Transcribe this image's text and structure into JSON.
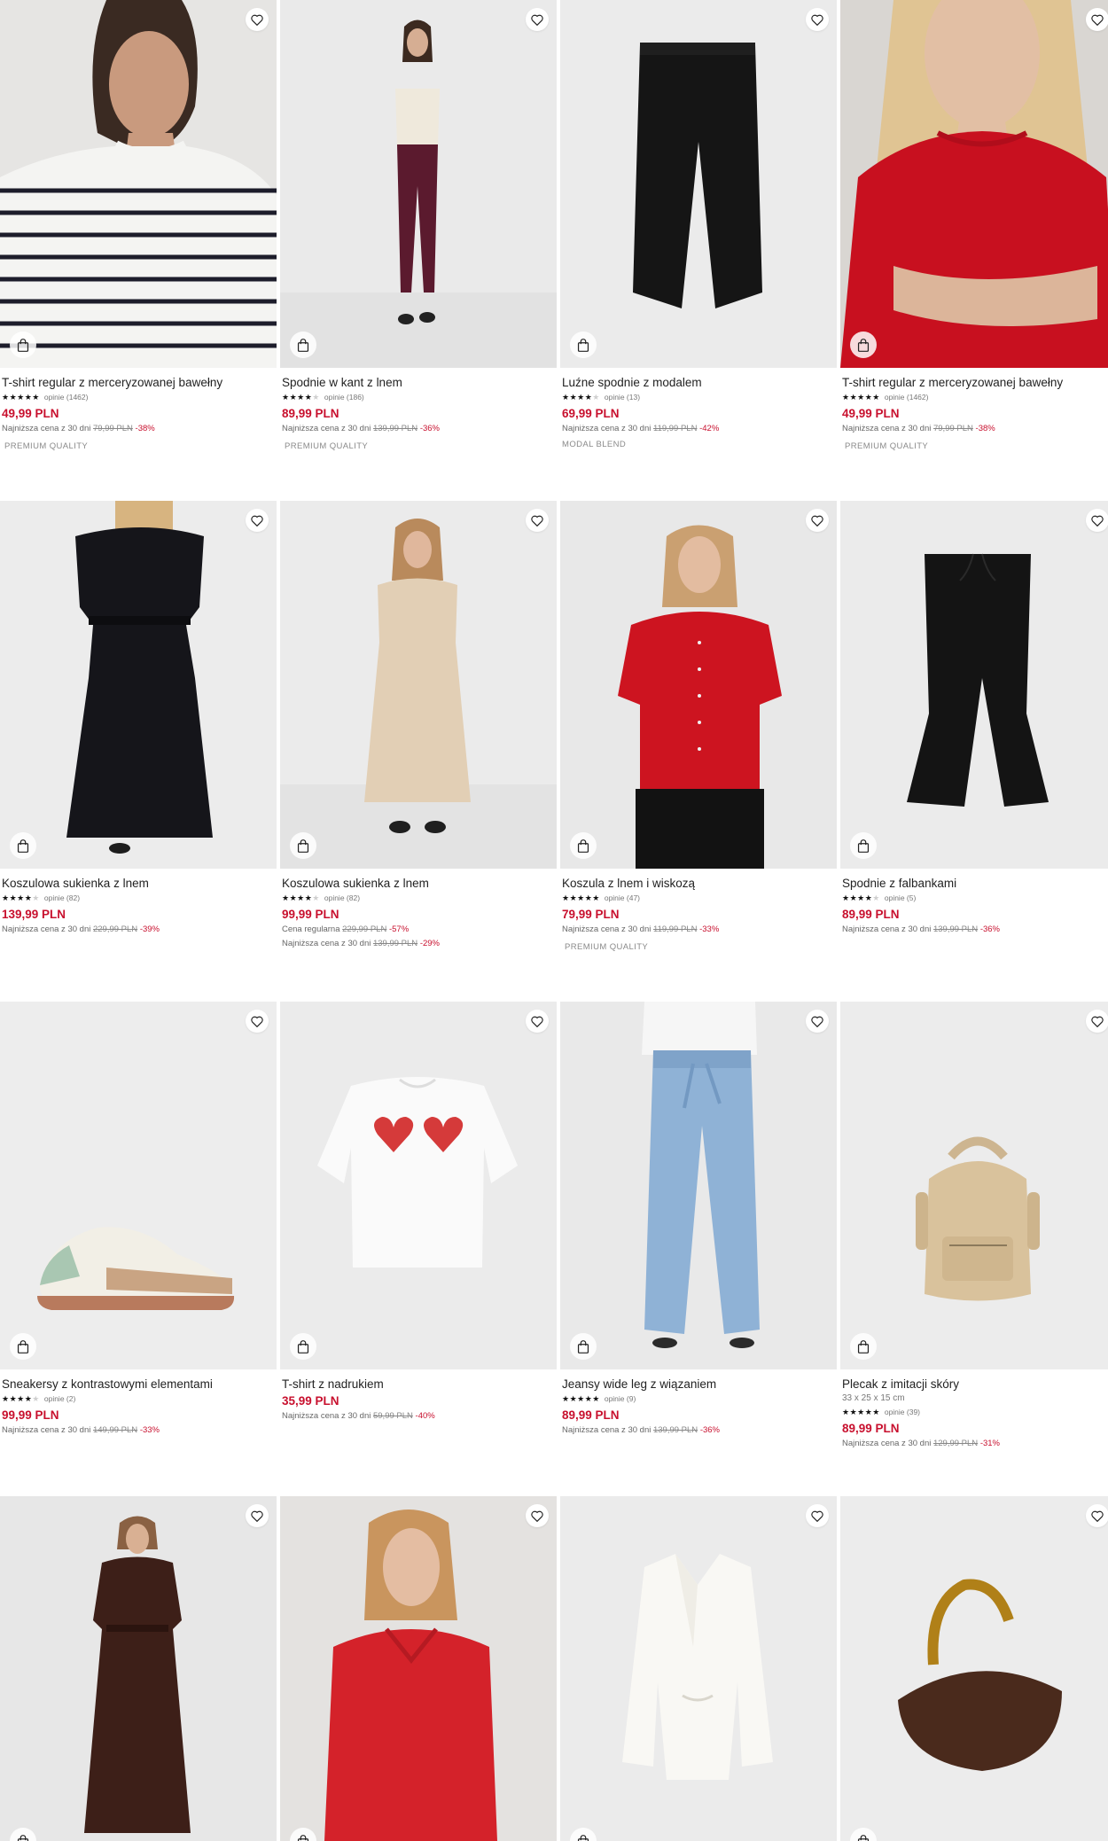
{
  "colors": {
    "accent": "#c8102e",
    "text": "#222222",
    "muted": "#777777",
    "star": "#111111"
  },
  "products": [
    {
      "name": "T-shirt regular z merceryzowanej bawełny",
      "rating": 5,
      "reviews": "opinie (1462)",
      "price": "49,99 PLN",
      "note_label": "Najniższa cena z 30 dni",
      "old_price": "79,99 PLN",
      "discount": "-38%",
      "tag": "PREMIUM QUALITY",
      "image": "striped-tshirt"
    },
    {
      "name": "Spodnie w kant z lnem",
      "rating": 4.5,
      "reviews": "opinie (186)",
      "price": "89,99 PLN",
      "note_label": "Najniższa cena z 30 dni",
      "old_price": "139,99 PLN",
      "discount": "-36%",
      "tag": "PREMIUM QUALITY",
      "image": "burgundy-trousers"
    },
    {
      "name": "Luźne spodnie z modalem",
      "rating": 4.5,
      "reviews": "opinie (13)",
      "price": "69,99 PLN",
      "note_label": "Najniższa cena z 30 dni",
      "old_price": "119,99 PLN",
      "discount": "-42%",
      "tag": "MODAL BLEND",
      "image": "black-wide-pants"
    },
    {
      "name": "T-shirt regular z merceryzowanej bawełny",
      "rating": 5,
      "reviews": "opinie (1462)",
      "price": "49,99 PLN",
      "note_label": "Najniższa cena z 30 dni",
      "old_price": "79,99 PLN",
      "discount": "-38%",
      "tag": "PREMIUM QUALITY",
      "image": "red-tshirt"
    },
    {
      "name": "Koszulowa sukienka z lnem",
      "rating": 4.5,
      "reviews": "opinie (82)",
      "price": "139,99 PLN",
      "note_label": "Najniższa cena z 30 dni",
      "old_price": "229,99 PLN",
      "discount": "-39%",
      "image": "black-shirt-dress"
    },
    {
      "name": "Koszulowa sukienka z lnem",
      "rating": 4.5,
      "reviews": "opinie (82)",
      "price": "99,99 PLN",
      "regular_label": "Cena regularna",
      "regular_old": "229,99 PLN",
      "regular_discount": "-57%",
      "note_label": "Najniższa cena z 30 dni",
      "old_price": "139,99 PLN",
      "discount": "-29%",
      "image": "beige-shirt-dress"
    },
    {
      "name": "Koszula z lnem i wiskozą",
      "rating": 5,
      "reviews": "opinie (47)",
      "price": "79,99 PLN",
      "note_label": "Najniższa cena z 30 dni",
      "old_price": "119,99 PLN",
      "discount": "-33%",
      "tag": "PREMIUM QUALITY",
      "image": "red-shirt"
    },
    {
      "name": "Spodnie z falbankami",
      "rating": 4.5,
      "reviews": "opinie (5)",
      "price": "89,99 PLN",
      "note_label": "Najniższa cena z 30 dni",
      "old_price": "139,99 PLN",
      "discount": "-36%",
      "image": "black-knit-pants"
    },
    {
      "name": "Sneakersy z kontrastowymi elementami",
      "rating": 4,
      "reviews": "opinie (2)",
      "price": "99,99 PLN",
      "note_label": "Najniższa cena z 30 dni",
      "old_price": "149,99 PLN",
      "discount": "-33%",
      "image": "sneaker"
    },
    {
      "name": "T-shirt z nadrukiem",
      "price": "35,99 PLN",
      "note_label": "Najniższa cena z 30 dni",
      "old_price": "59,99 PLN",
      "discount": "-40%",
      "image": "heart-tshirt"
    },
    {
      "name": "Jeansy wide leg z wiązaniem",
      "rating": 5,
      "reviews": "opinie (9)",
      "price": "89,99 PLN",
      "note_label": "Najniższa cena z 30 dni",
      "old_price": "139,99 PLN",
      "discount": "-36%",
      "image": "wide-jeans"
    },
    {
      "name": "Plecak z imitacji skóry",
      "dims": "33 x 25 x 15 cm",
      "rating": 5,
      "reviews": "opinie (39)",
      "price": "89,99 PLN",
      "note_label": "Najniższa cena z 30 dni",
      "old_price": "129,99 PLN",
      "discount": "-31%",
      "image": "backpack"
    },
    {
      "image": "brown-shirt-dress"
    },
    {
      "image": "red-dress"
    },
    {
      "image": "white-blazer"
    },
    {
      "image": "brown-bag"
    }
  ],
  "icons": {
    "favorite": "heart-outline-icon",
    "add_to_cart": "shopping-bag-icon"
  }
}
